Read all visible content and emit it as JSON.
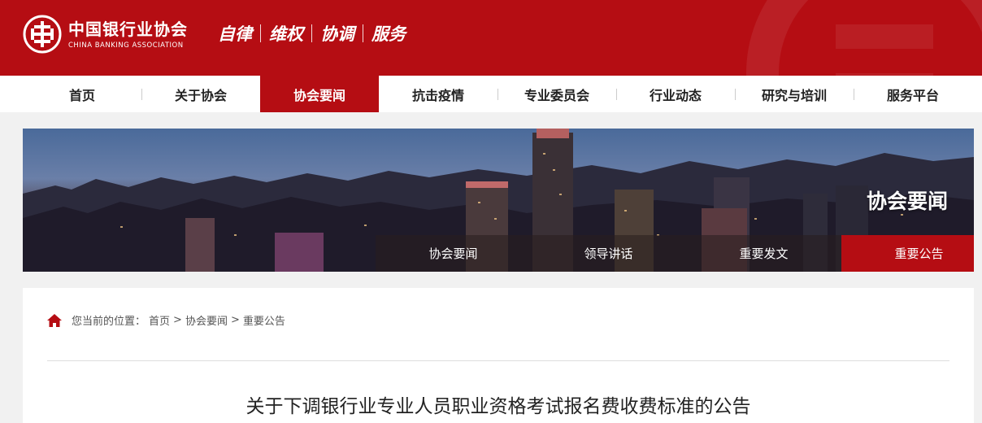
{
  "header": {
    "logo_cn": "中国银行业协会",
    "logo_en": "CHINA BANKING ASSOCIATION",
    "slogan": [
      "自律",
      "维权",
      "协调",
      "服务"
    ],
    "brand_color": "#b50d13"
  },
  "nav": {
    "items": [
      "首页",
      "关于协会",
      "协会要闻",
      "抗击疫情",
      "专业委员会",
      "行业动态",
      "研究与培训",
      "服务平台"
    ],
    "active": "协会要闻"
  },
  "banner": {
    "title": "协会要闻",
    "subnav": [
      "协会要闻",
      "领导讲话",
      "重要发文",
      "重要公告"
    ],
    "active": "重要公告"
  },
  "breadcrumb": {
    "icon": "home-icon",
    "prefix": "您当前的位置：",
    "items": [
      "首页",
      "协会要闻",
      "重要公告"
    ],
    "separator": ">"
  },
  "article": {
    "title": "关于下调银行业专业人员职业资格考试报名费收费标准的公告"
  }
}
